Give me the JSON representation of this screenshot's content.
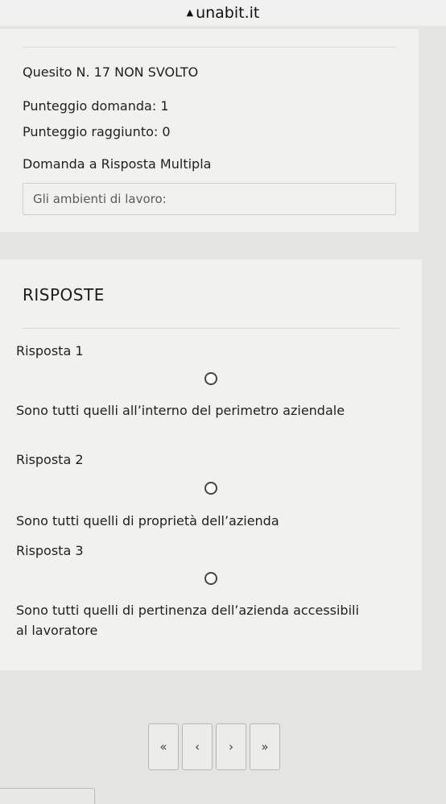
{
  "browser": {
    "lock_icon": "lock-icon",
    "url": "unabit.it"
  },
  "question": {
    "status": "Quesito N. 17 NON SVOLTO",
    "score_question": "Punteggio domanda: 1",
    "score_achieved": "Punteggio raggiunto: 0",
    "type": "Domanda a Risposta Multipla",
    "prompt": "Gli ambienti di lavoro:"
  },
  "answers": {
    "title": "RISPOSTE",
    "items": [
      {
        "label": "Risposta 1",
        "text": "Sono tutti quelli all’interno del perimetro aziendale",
        "selected": false
      },
      {
        "label": "Risposta 2",
        "text": "Sono tutti quelli di proprietà dell’azienda",
        "selected": false
      },
      {
        "label": "Risposta 3",
        "text": "Sono tutti quelli di pertinenza dell’azienda accessibili al lavoratore",
        "selected": false
      }
    ]
  },
  "pagination": {
    "first": "«",
    "prev": "‹",
    "next": "›",
    "last": "»"
  }
}
